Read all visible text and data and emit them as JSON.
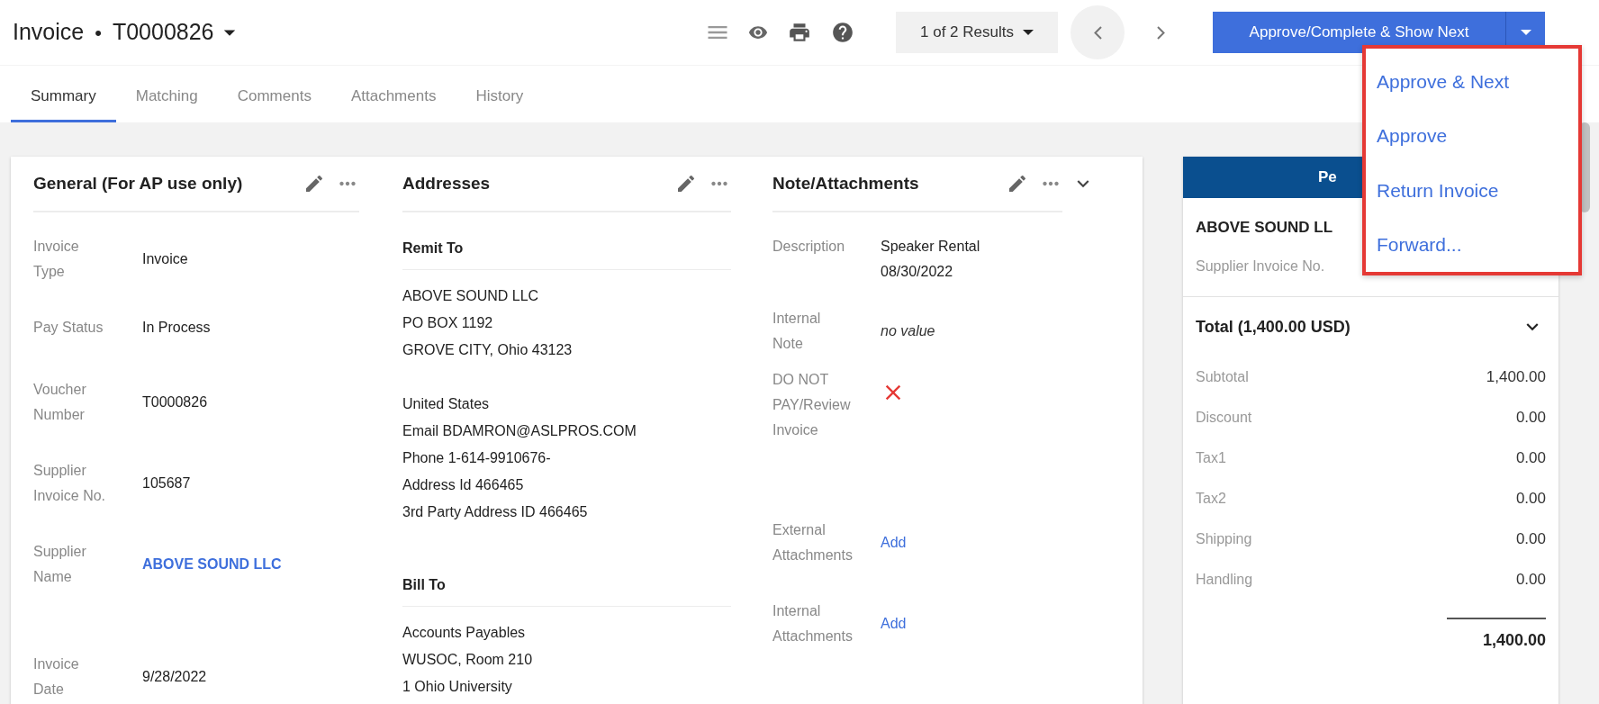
{
  "header": {
    "record_type": "Invoice",
    "separator": "•",
    "record_id": "T0000826"
  },
  "results": "1 of 2 Results",
  "primary_action": "Approve/Complete & Show Next",
  "action_menu": {
    "open": true,
    "items": [
      "Approve & Next",
      "Approve",
      "Return Invoice",
      "Forward..."
    ]
  },
  "tabs": [
    {
      "label": "Summary",
      "selected": true
    },
    {
      "label": "Matching",
      "selected": false
    },
    {
      "label": "Comments",
      "selected": false
    },
    {
      "label": "Attachments",
      "selected": false
    },
    {
      "label": "History",
      "selected": false
    }
  ],
  "general": {
    "title": "General (For AP use only)",
    "fields": [
      {
        "label": "Invoice Type",
        "value": "Invoice",
        "kind": "text"
      },
      {
        "label": "Pay Status",
        "value": "In Process",
        "kind": "text"
      },
      {
        "label": "Voucher Number",
        "value": "T0000826",
        "kind": "text"
      },
      {
        "label": "Supplier Invoice No.",
        "value": "105687",
        "kind": "text"
      },
      {
        "label": "Supplier Name",
        "value": "ABOVE SOUND LLC",
        "kind": "link"
      },
      {
        "label": "Invoice Date",
        "value": "9/28/2022",
        "kind": "text"
      }
    ]
  },
  "addresses": {
    "title": "Addresses",
    "sections": [
      {
        "heading": "Remit To",
        "blocks": [
          [
            "ABOVE SOUND LLC",
            "PO BOX 1192",
            "GROVE CITY, Ohio 43123"
          ],
          [
            "United States",
            "Email BDAMRON@ASLPROS.COM",
            "Phone 1-614-9910676-",
            "Address Id 466465",
            "3rd Party Address ID 466465"
          ]
        ]
      },
      {
        "heading": "Bill To",
        "blocks": [
          [
            "Accounts Payables",
            "WUSOC, Room 210",
            "1 Ohio University"
          ]
        ]
      }
    ]
  },
  "notes": {
    "title": "Note/Attachments",
    "expanded": true,
    "fields": [
      {
        "label": "Description",
        "value": "Speaker Rental 08/30/2022",
        "kind": "text"
      },
      {
        "label": "Internal Note",
        "value": "no value",
        "kind": "empty"
      },
      {
        "label": "DO NOT PAY/Review Invoice",
        "kind": "flag",
        "checked": false
      },
      {
        "label": "External Attachments",
        "value": "Add",
        "kind": "link"
      },
      {
        "label": "Internal Attachments",
        "value": "Add",
        "kind": "link"
      }
    ]
  },
  "summary_panel": {
    "header": "Pe",
    "supplier": "ABOVE SOUND LL",
    "supplier_invoice_label": "Supplier Invoice No.",
    "total": {
      "title": "Total (1,400.00 USD)",
      "expanded": true,
      "rows": [
        {
          "label": "Subtotal",
          "value": "1,400.00"
        },
        {
          "label": "Discount",
          "value": "0.00"
        },
        {
          "label": "Tax1",
          "value": "0.00"
        },
        {
          "label": "Tax2",
          "value": "0.00"
        },
        {
          "label": "Shipping",
          "value": "0.00"
        },
        {
          "label": "Handling",
          "value": "0.00"
        }
      ],
      "sum": "1,400.00"
    }
  }
}
